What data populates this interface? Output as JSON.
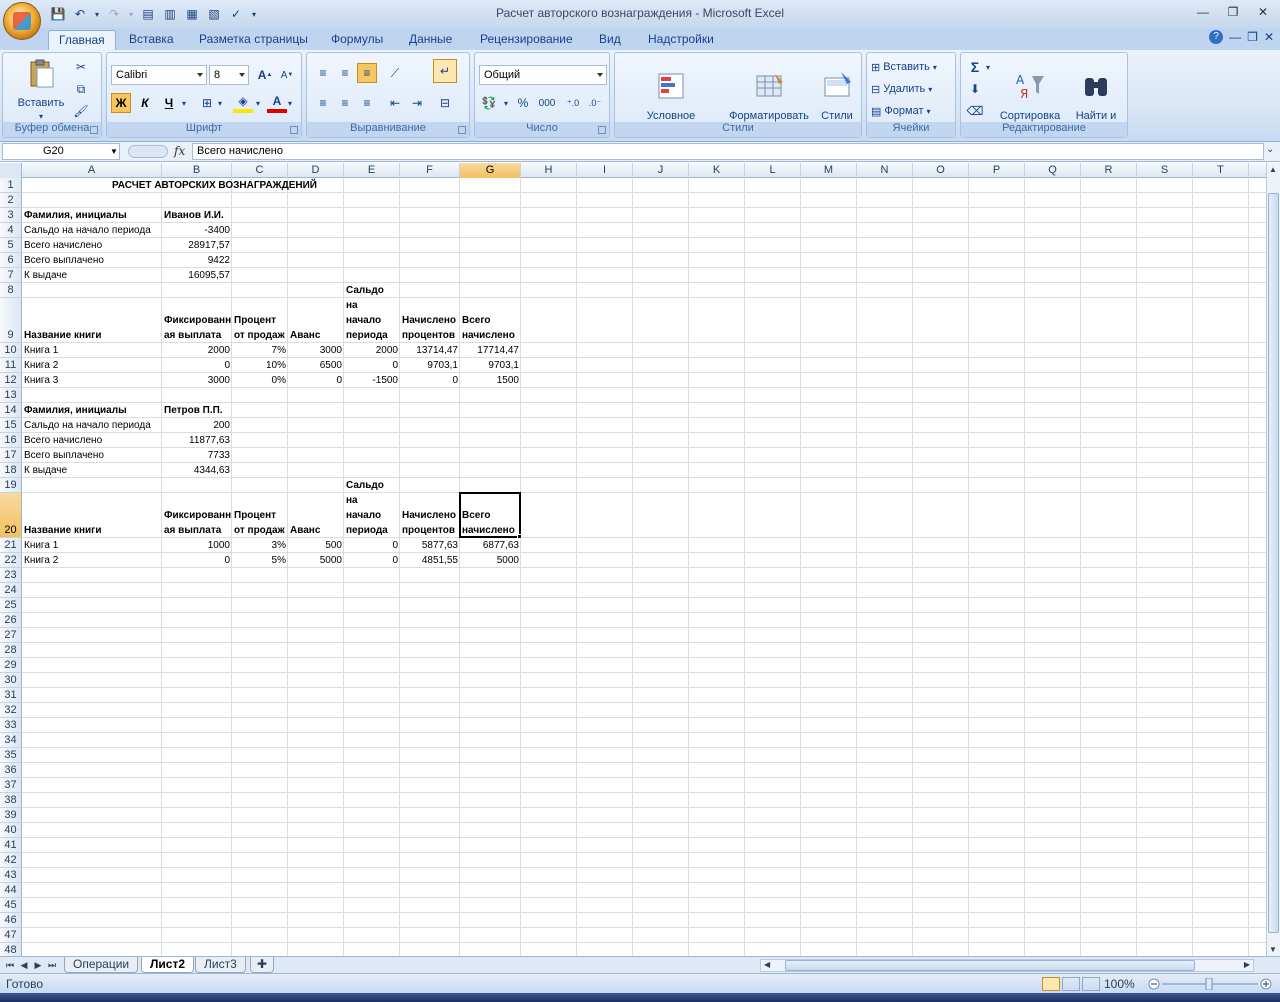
{
  "window": {
    "title": "Расчет авторского вознаграждения - Microsoft Excel"
  },
  "ribbon_tabs": [
    "Главная",
    "Вставка",
    "Разметка страницы",
    "Формулы",
    "Данные",
    "Рецензирование",
    "Вид",
    "Надстройки"
  ],
  "ribbon": {
    "clipboard": {
      "label": "Буфер обмена",
      "paste": "Вставить"
    },
    "font": {
      "label": "Шрифт",
      "name": "Calibri",
      "size": "8",
      "bold": "Ж",
      "italic": "К",
      "underline": "Ч",
      "grow": "A",
      "shrink": "A"
    },
    "alignment": {
      "label": "Выравнивание"
    },
    "number": {
      "label": "Число",
      "format": "Общий",
      "percent": "%",
      "thousands": "000"
    },
    "styles": {
      "label": "Стили",
      "conditional": "Условное\nформатирование",
      "format_table": "Форматировать\nкак таблицу",
      "cell_styles": "Стили\nячеек"
    },
    "cells": {
      "label": "Ячейки",
      "insert": "Вставить",
      "delete": "Удалить",
      "format": "Формат"
    },
    "editing": {
      "label": "Редактирование",
      "sigma": "Σ",
      "sort": "Сортировка\nи фильтр",
      "find": "Найти и\nвыделить"
    }
  },
  "formula_bar": {
    "name_box": "G20",
    "fx": "fx",
    "content": "Всего начислено"
  },
  "columns": [
    "A",
    "B",
    "C",
    "D",
    "E",
    "F",
    "G",
    "H",
    "I",
    "J",
    "K",
    "L",
    "M",
    "N",
    "O",
    "P",
    "Q",
    "R",
    "S",
    "T"
  ],
  "selected_column": "G",
  "selected_row": "20",
  "rows": [
    "1",
    "2",
    "3",
    "4",
    "5",
    "6",
    "7",
    "8",
    "9",
    "10",
    "11",
    "12",
    "13",
    "14",
    "15",
    "16",
    "17",
    "18",
    "19",
    "20",
    "21",
    "22",
    "23",
    "24",
    "25",
    "26",
    "27",
    "28",
    "29",
    "30",
    "31",
    "32",
    "33",
    "34",
    "35",
    "36",
    "37",
    "38",
    "39",
    "40",
    "41",
    "42",
    "43",
    "44",
    "45",
    "46",
    "47",
    "48"
  ],
  "sheet": {
    "title": "РАСЧЕТ АВТОРСКИХ ВОЗНАГРАЖДЕНИЙ",
    "block1": {
      "name_label": "Фамилия, инициалы",
      "name_value": "Иванов И.И.",
      "rows": [
        {
          "label": "Сальдо на начало периода",
          "value": "-3400"
        },
        {
          "label": "Всего начислено",
          "value": "28917,57"
        },
        {
          "label": "Всего выплачено",
          "value": "9422"
        },
        {
          "label": "К выдаче",
          "value": "16095,57"
        }
      ],
      "headers": [
        "Название книги",
        "Фиксированн ая выплата",
        "Процент от продаж",
        "Аванс",
        "Сальдо на начало периода",
        "Начислено процентов",
        "Всего начислено"
      ],
      "books": [
        [
          "Книга 1",
          "2000",
          "7%",
          "3000",
          "2000",
          "13714,47",
          "17714,47"
        ],
        [
          "Книга 2",
          "0",
          "10%",
          "6500",
          "0",
          "9703,1",
          "9703,1"
        ],
        [
          "Книга 3",
          "3000",
          "0%",
          "0",
          "-1500",
          "0",
          "1500"
        ]
      ]
    },
    "block2": {
      "name_label": "Фамилия, инициалы",
      "name_value": "Петров П.П.",
      "rows": [
        {
          "label": "Сальдо на начало периода",
          "value": "200"
        },
        {
          "label": "Всего начислено",
          "value": "11877,63"
        },
        {
          "label": "Всего выплачено",
          "value": "7733"
        },
        {
          "label": "К выдаче",
          "value": "4344,63"
        }
      ],
      "headers": [
        "Название книги",
        "Фиксированн ая выплата",
        "Процент от продаж",
        "Аванс",
        "Сальдо на начало периода",
        "Начислено процентов",
        "Всего начислено"
      ],
      "books": [
        [
          "Книга 1",
          "1000",
          "3%",
          "500",
          "0",
          "5877,63",
          "6877,63"
        ],
        [
          "Книга 2",
          "0",
          "5%",
          "5000",
          "0",
          "4851,55",
          "5000"
        ]
      ]
    }
  },
  "sheet_tabs": [
    "Операции",
    "Лист2",
    "Лист3"
  ],
  "active_sheet": "Лист2",
  "status": {
    "ready": "Готово",
    "zoom": "100%"
  }
}
